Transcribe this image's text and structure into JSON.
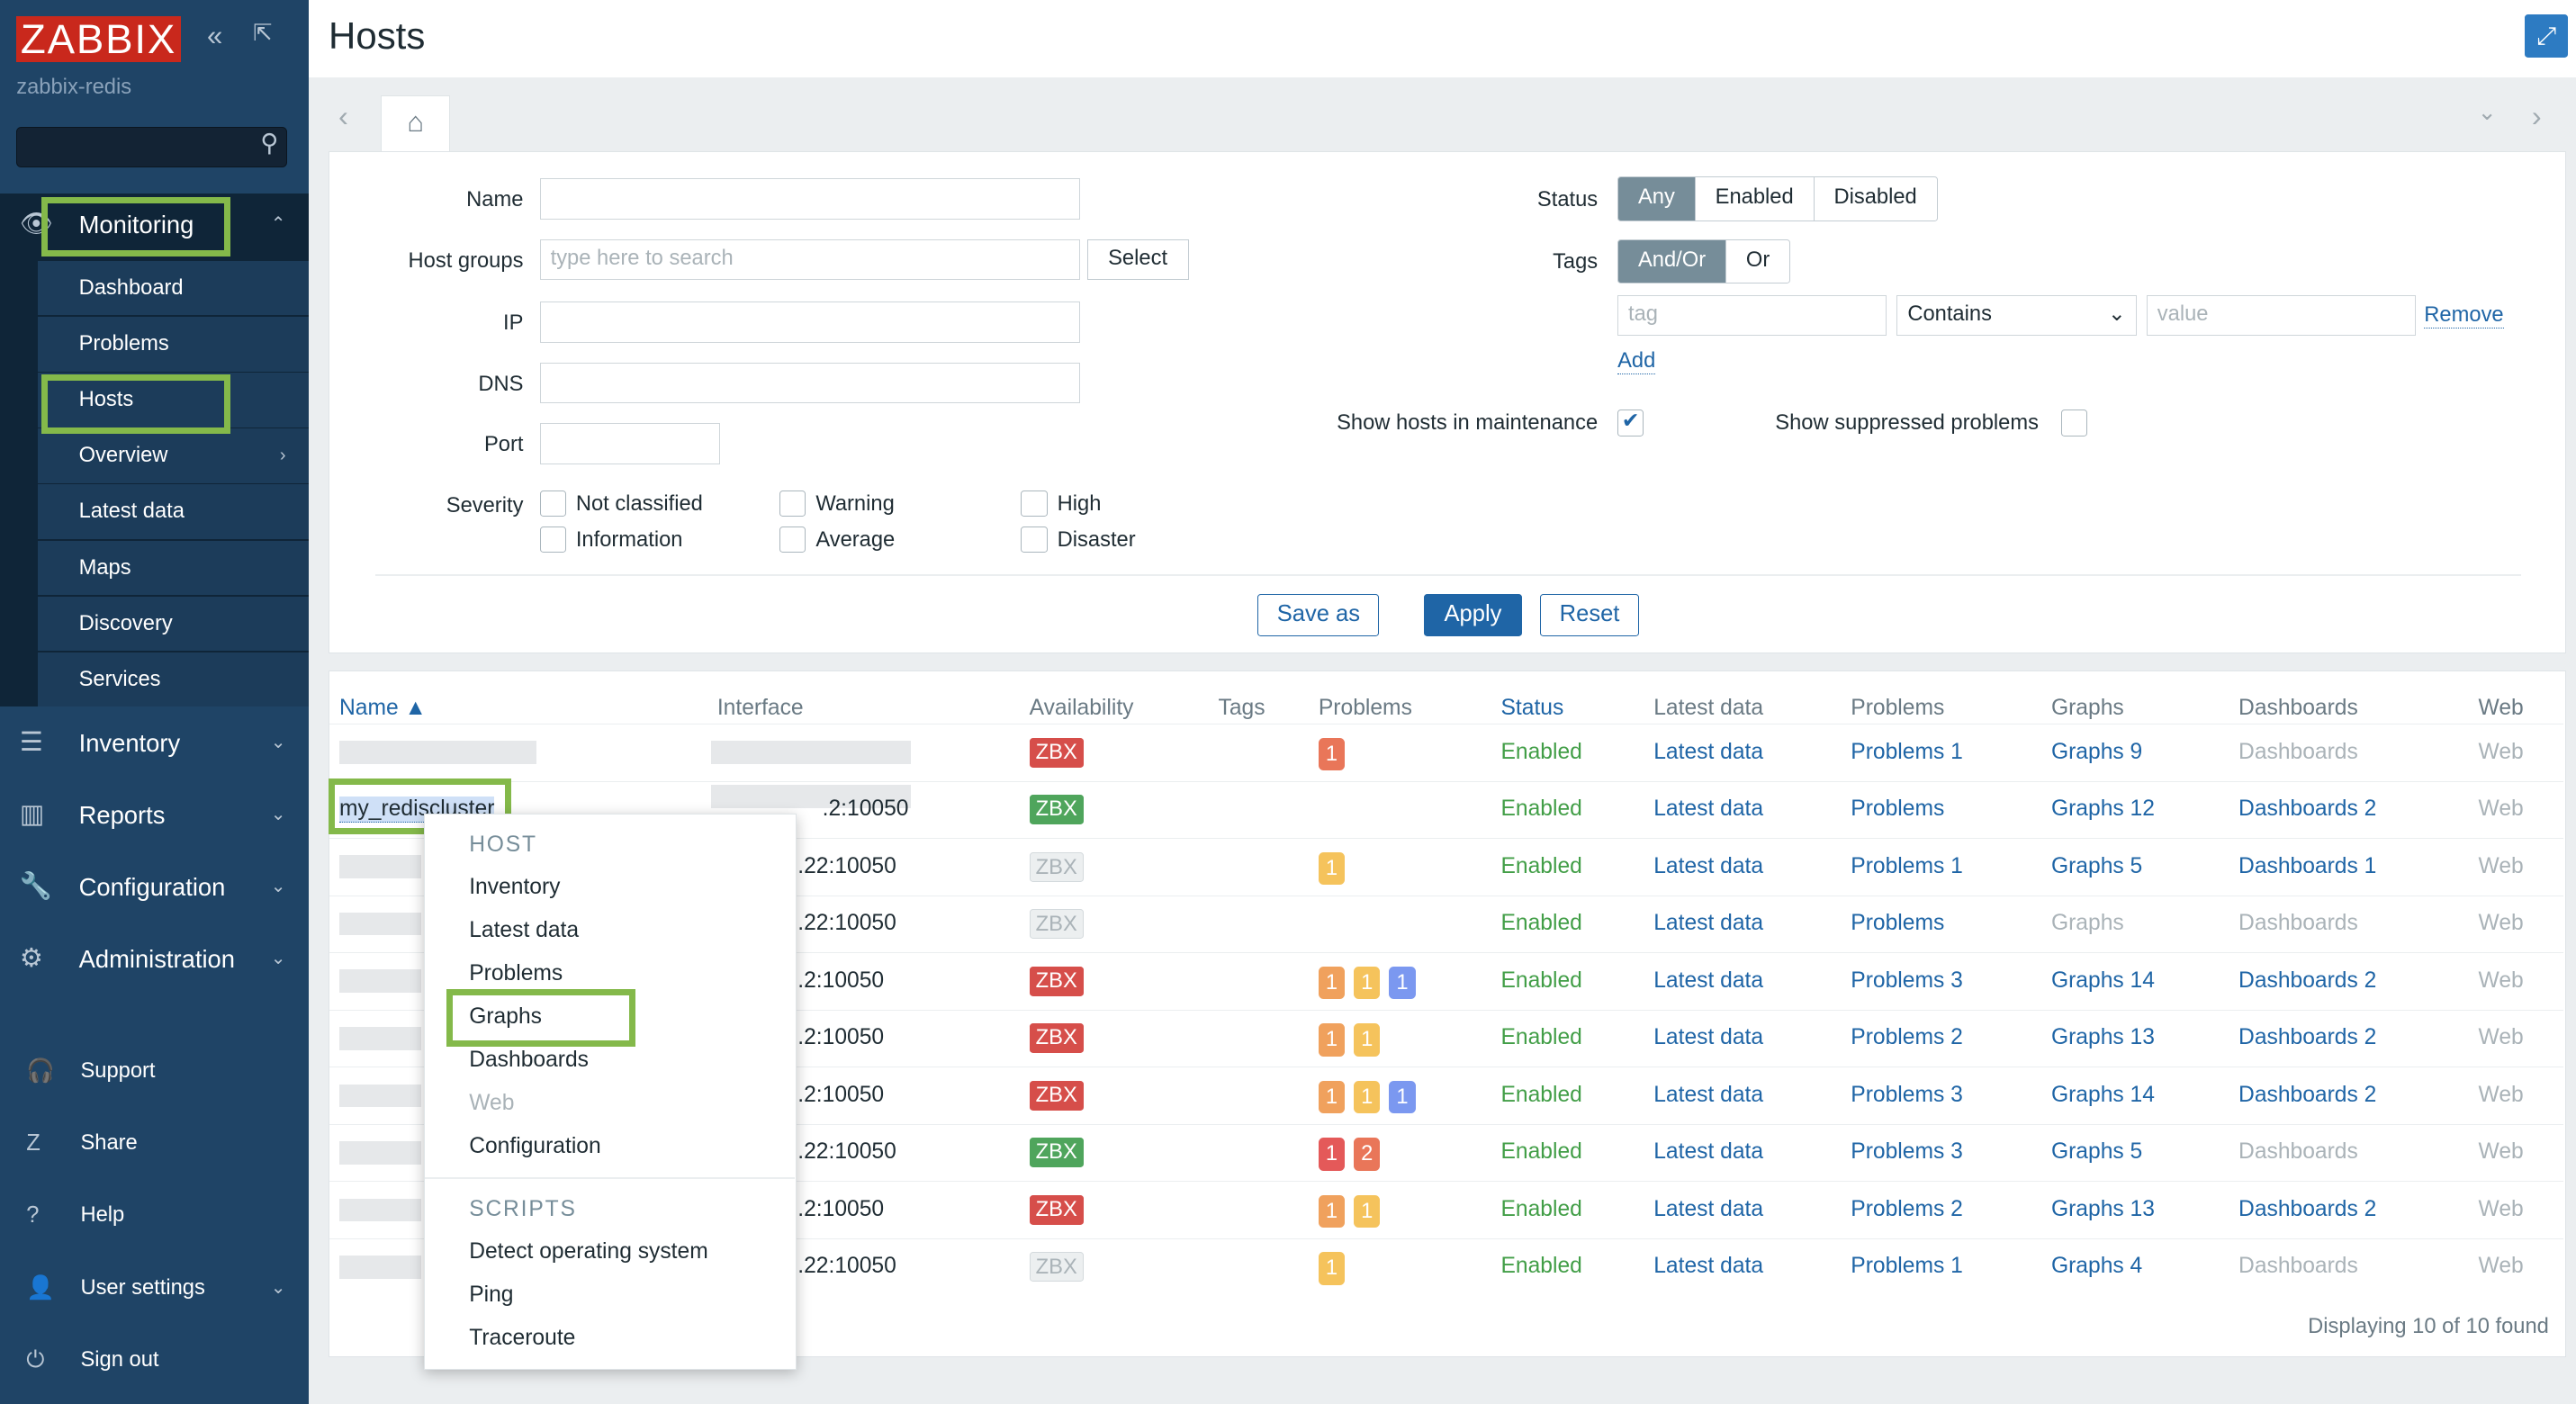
{
  "sidebar": {
    "logo": "ZABBIX",
    "server": "zabbix-redis",
    "collapse_icon": "double-chevron-left",
    "kiosk_icon": "kiosk-mode",
    "monitoring": {
      "label": "Monitoring",
      "items": [
        "Dashboard",
        "Problems",
        "Hosts",
        "Overview",
        "Latest data",
        "Maps",
        "Discovery",
        "Services"
      ]
    },
    "sections": [
      "Inventory",
      "Reports",
      "Configuration",
      "Administration"
    ],
    "bottom": [
      "Support",
      "Share",
      "Help",
      "User settings",
      "Sign out"
    ]
  },
  "header": {
    "title": "Hosts"
  },
  "filter": {
    "name_label": "Name",
    "name_value": "",
    "groups_label": "Host groups",
    "groups_placeholder": "type here to search",
    "select_label": "Select",
    "ip_label": "IP",
    "dns_label": "DNS",
    "port_label": "Port",
    "severity_label": "Severity",
    "severities": [
      "Not classified",
      "Information",
      "Warning",
      "Average",
      "High",
      "Disaster"
    ],
    "status_label": "Status",
    "status_options": [
      "Any",
      "Enabled",
      "Disabled"
    ],
    "status_selected": "Any",
    "tags_label": "Tags",
    "tags_options": [
      "And/Or",
      "Or"
    ],
    "tags_selected": "And/Or",
    "tag_placeholder": "tag",
    "operator": "Contains",
    "value_placeholder": "value",
    "remove_label": "Remove",
    "add_label": "Add",
    "maintenance_label": "Show hosts in maintenance",
    "maintenance_checked": true,
    "suppressed_label": "Show suppressed problems",
    "suppressed_checked": false,
    "save_as": "Save as",
    "apply": "Apply",
    "reset": "Reset"
  },
  "table": {
    "columns": [
      "Name ▲",
      "Interface",
      "Availability",
      "Tags",
      "Problems",
      "Status",
      "Latest data",
      "Problems",
      "Graphs",
      "Dashboards",
      "Web"
    ],
    "rows": [
      {
        "name": "",
        "interface": "",
        "avail": "red",
        "problems": [
          {
            "n": "1",
            "c": "#e97659"
          }
        ],
        "status": "Enabled",
        "latest": "Latest data",
        "problems_link": "Problems 1",
        "graphs": "Graphs 9",
        "graphs_active": true,
        "dashboards": "Dashboards",
        "dash_active": false,
        "web": "Web"
      },
      {
        "name": "my_rediscluster",
        "interface": ".2:10050",
        "avail": "green",
        "problems": [],
        "status": "Enabled",
        "latest": "Latest data",
        "problems_link": "Problems",
        "graphs": "Graphs 12",
        "graphs_active": true,
        "dashboards": "Dashboards 2",
        "dash_active": true,
        "web": "Web"
      },
      {
        "name": "",
        "interface": ".22:10050",
        "avail": "gray",
        "problems": [
          {
            "n": "1",
            "c": "#f5c35c"
          }
        ],
        "status": "Enabled",
        "latest": "Latest data",
        "problems_link": "Problems 1",
        "graphs": "Graphs 5",
        "graphs_active": true,
        "dashboards": "Dashboards 1",
        "dash_active": true,
        "web": "Web"
      },
      {
        "name": "",
        "interface": ".22:10050",
        "avail": "gray",
        "problems": [],
        "status": "Enabled",
        "latest": "Latest data",
        "problems_link": "Problems",
        "graphs": "Graphs",
        "graphs_active": false,
        "dashboards": "Dashboards",
        "dash_active": false,
        "web": "Web"
      },
      {
        "name": "",
        "interface": ".2:10050",
        "avail": "red",
        "problems": [
          {
            "n": "1",
            "c": "#f0a15d"
          },
          {
            "n": "1",
            "c": "#f5c35c"
          },
          {
            "n": "1",
            "c": "#7b98f0"
          }
        ],
        "status": "Enabled",
        "latest": "Latest data",
        "problems_link": "Problems 3",
        "graphs": "Graphs 14",
        "graphs_active": true,
        "dashboards": "Dashboards 2",
        "dash_active": true,
        "web": "Web"
      },
      {
        "name": "",
        "interface": ".2:10050",
        "avail": "red",
        "problems": [
          {
            "n": "1",
            "c": "#f0a15d"
          },
          {
            "n": "1",
            "c": "#f5c35c"
          }
        ],
        "status": "Enabled",
        "latest": "Latest data",
        "problems_link": "Problems 2",
        "graphs": "Graphs 13",
        "graphs_active": true,
        "dashboards": "Dashboards 2",
        "dash_active": true,
        "web": "Web"
      },
      {
        "name": "",
        "interface": ".2:10050",
        "avail": "red",
        "problems": [
          {
            "n": "1",
            "c": "#f0a15d"
          },
          {
            "n": "1",
            "c": "#f5c35c"
          },
          {
            "n": "1",
            "c": "#7b98f0"
          }
        ],
        "status": "Enabled",
        "latest": "Latest data",
        "problems_link": "Problems 3",
        "graphs": "Graphs 14",
        "graphs_active": true,
        "dashboards": "Dashboards 2",
        "dash_active": true,
        "web": "Web"
      },
      {
        "name": "",
        "interface": ".22:10050",
        "avail": "green",
        "problems": [
          {
            "n": "1",
            "c": "#e45959"
          },
          {
            "n": "2",
            "c": "#e97659"
          }
        ],
        "status": "Enabled",
        "latest": "Latest data",
        "problems_link": "Problems 3",
        "graphs": "Graphs 5",
        "graphs_active": true,
        "dashboards": "Dashboards",
        "dash_active": false,
        "web": "Web"
      },
      {
        "name": "",
        "interface": ".2:10050",
        "avail": "red",
        "problems": [
          {
            "n": "1",
            "c": "#f0a15d"
          },
          {
            "n": "1",
            "c": "#f5c35c"
          }
        ],
        "status": "Enabled",
        "latest": "Latest data",
        "problems_link": "Problems 2",
        "graphs": "Graphs 13",
        "graphs_active": true,
        "dashboards": "Dashboards 2",
        "dash_active": true,
        "web": "Web"
      },
      {
        "name": "",
        "interface": ".22:10050",
        "avail": "gray",
        "problems": [
          {
            "n": "1",
            "c": "#f5c35c"
          }
        ],
        "status": "Enabled",
        "latest": "Latest data",
        "problems_link": "Problems 1",
        "graphs": "Graphs 4",
        "graphs_active": true,
        "dashboards": "Dashboards",
        "dash_active": false,
        "web": "Web"
      }
    ],
    "avail_label": "ZBX",
    "footer": "Displaying 10 of 10 found"
  },
  "context_menu": {
    "host_header": "HOST",
    "host_items": [
      "Inventory",
      "Latest data",
      "Problems",
      "Graphs",
      "Dashboards",
      "Web",
      "Configuration"
    ],
    "disabled": [
      "Web"
    ],
    "scripts_header": "SCRIPTS",
    "scripts": [
      "Detect operating system",
      "Ping",
      "Traceroute"
    ]
  },
  "colors": {
    "sidebar": "#1f4466",
    "accent": "#1f65a6",
    "highlight": "#84b94a",
    "enabled": "#429e47"
  }
}
